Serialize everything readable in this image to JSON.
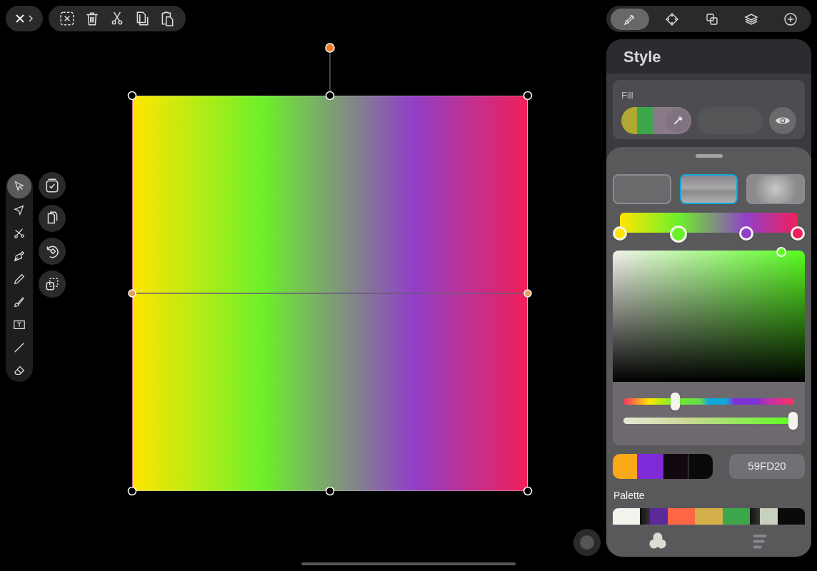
{
  "edit_toolbar": [
    {
      "kind": "deselect"
    },
    {
      "kind": "delete"
    },
    {
      "kind": "cut"
    },
    {
      "kind": "copy"
    },
    {
      "kind": "paste"
    }
  ],
  "tools": [
    {
      "kind": "select",
      "selected": true
    },
    {
      "kind": "direct",
      "selected": false
    },
    {
      "kind": "scissors",
      "selected": false
    },
    {
      "kind": "pen",
      "selected": false
    },
    {
      "kind": "pencil",
      "selected": false
    },
    {
      "kind": "brush",
      "selected": false
    },
    {
      "kind": "text",
      "selected": false
    },
    {
      "kind": "line",
      "selected": false
    },
    {
      "kind": "eraser",
      "selected": false
    }
  ],
  "quick_actions": [
    {
      "kind": "check"
    },
    {
      "kind": "duplicate"
    },
    {
      "kind": "rotate"
    },
    {
      "kind": "transform"
    }
  ],
  "inspector_tabs": [
    {
      "kind": "style",
      "selected": true
    },
    {
      "kind": "node",
      "selected": false
    },
    {
      "kind": "boolean",
      "selected": false
    },
    {
      "kind": "layers",
      "selected": false
    },
    {
      "kind": "add",
      "selected": false
    }
  ],
  "style_panel": {
    "title": "Style",
    "fill_label": "Fill",
    "gradient_types": [
      {
        "kind": "solid",
        "selected": false
      },
      {
        "kind": "linear",
        "selected": true
      },
      {
        "kind": "radial",
        "selected": false
      }
    ],
    "gradient_stops": [
      {
        "color": "#ffe600",
        "level": 0,
        "selected": false
      },
      {
        "color": "#6cf02a",
        "level": 0.33,
        "selected": true
      },
      {
        "color": "#9040c8",
        "level": 0.71,
        "selected": false
      },
      {
        "color": "#f0205a",
        "level": 1,
        "selected": false
      }
    ],
    "hue_slider": {
      "level": 0.3
    },
    "tone_slider": {
      "level": 1
    },
    "recent_colors": [
      {
        "color": "#f9a818"
      },
      {
        "color": "#7e2ad8"
      },
      {
        "color": "#120810"
      },
      {
        "color": "#0a0a0a"
      }
    ],
    "hex_value": "59FD20",
    "palette_label": "Palette",
    "palette": [
      {
        "kind": "solid",
        "color": "#f4f4ee"
      },
      {
        "kind": "gradient",
        "color": "#5a2a9a"
      },
      {
        "kind": "solid",
        "color": "#ff6644"
      },
      {
        "kind": "solid",
        "color": "#d4b04a"
      },
      {
        "kind": "solid",
        "color": "#3ca64a"
      },
      {
        "kind": "gradient",
        "color": "#c8d0c0"
      },
      {
        "kind": "solid",
        "color": "#0a0a0a"
      }
    ],
    "bottom_tabs": [
      {
        "kind": "color",
        "selected": true
      },
      {
        "kind": "list",
        "selected": false
      }
    ]
  }
}
